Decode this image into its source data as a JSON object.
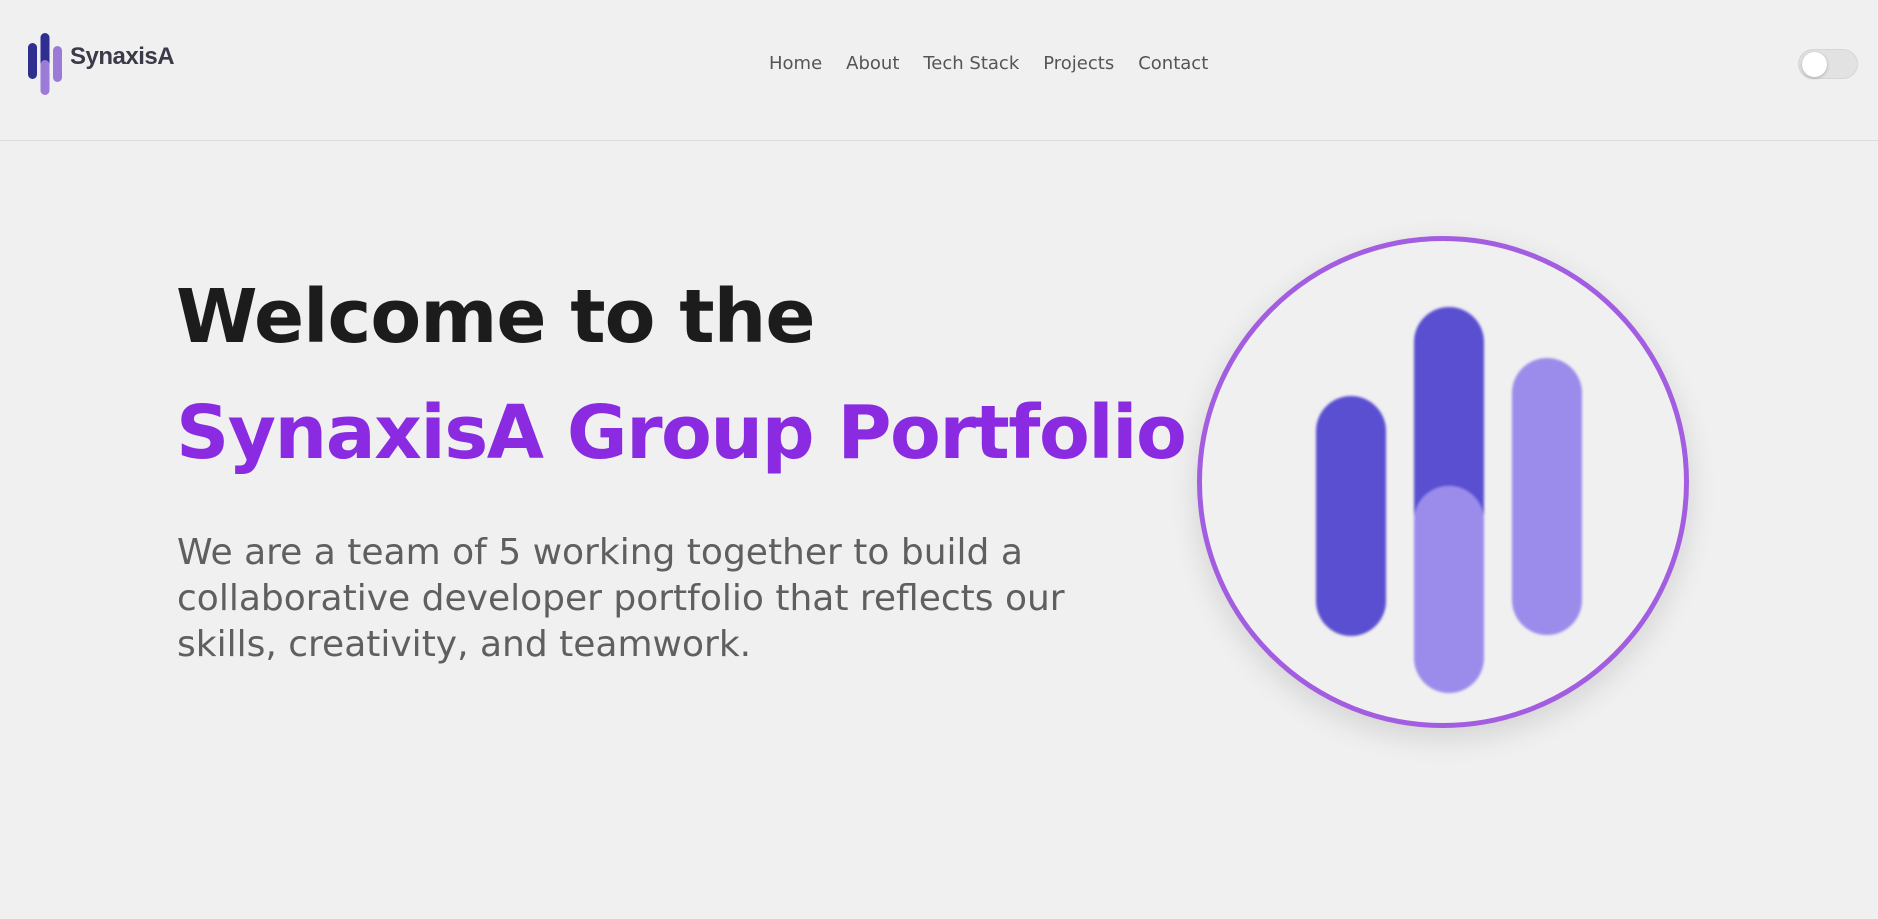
{
  "header": {
    "brand": "SynaxisA",
    "logo_icon": "bars-logo-icon",
    "nav": [
      {
        "label": "Home"
      },
      {
        "label": "About"
      },
      {
        "label": "Tech Stack"
      },
      {
        "label": "Projects"
      },
      {
        "label": "Contact"
      }
    ],
    "theme_toggle": {
      "state": "off"
    }
  },
  "hero": {
    "title_line1": "Welcome to the",
    "title_line2": "SynaxisA Group Portfolio",
    "description": "We are a team of 5 working together to build a collaborative developer portfolio that reflects our skills, creativity, and teamwork.",
    "image_icon": "bars-logo-icon"
  },
  "colors": {
    "background": "#f0f0f0",
    "accent": "#8a2be2",
    "ring": "#a25de0",
    "bar_dark": "#5a4fd1",
    "bar_light": "#9b8cec",
    "logo_navy": "#2e2f8f",
    "logo_purple": "#9b7ad8"
  }
}
